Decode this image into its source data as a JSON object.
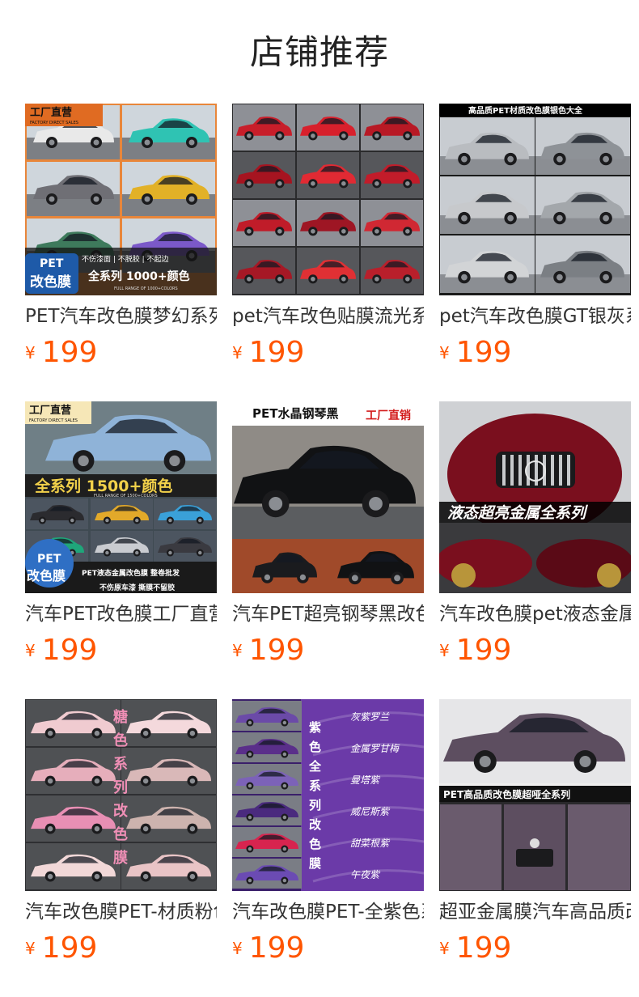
{
  "header": {
    "title": "店铺推荐"
  },
  "products": [
    {
      "name": "PET汽车改色膜梦幻系列",
      "currency": "¥",
      "price": "199",
      "image": {
        "kind": "grid-cars",
        "badge_top": "工厂直营",
        "badge_top_sub": "FACTORY DIRECT SALES",
        "badge_bottom": "PET",
        "badge_bottom_2": "改色膜",
        "tagline": "不伤漆面 | 不脱胶 | 不起边",
        "headline": "全系列 1000+颜色",
        "sub": "FULL RANGE OF 1000+COLORS",
        "colors": [
          "#e9e9e9",
          "#2fc3b3",
          "#6f6f75",
          "#e2b127",
          "#3e7a5c",
          "#7b59c9"
        ]
      }
    },
    {
      "name": "pet汽车改色贴膜流光系列",
      "currency": "¥",
      "price": "199",
      "image": {
        "kind": "red-grid",
        "colors": [
          "#c81e2a",
          "#d8202c",
          "#b81925",
          "#a61420",
          "#e12a33",
          "#c21c2a",
          "#c01c29",
          "#9e1624",
          "#d02833",
          "#a61825",
          "#e03034",
          "#b91f2b"
        ]
      }
    },
    {
      "name": "pet汽车改色膜GT银灰系列",
      "currency": "¥",
      "price": "199",
      "image": {
        "kind": "silver-grid",
        "banner": "高品质PET材质改色膜银色大全",
        "colors": [
          "#b9bcc0",
          "#8e9297",
          "#c7c9cc",
          "#a3a7ab",
          "#d2d4d6",
          "#7b7f84"
        ]
      }
    },
    {
      "name": "汽车PET改色膜工厂直营",
      "currency": "¥",
      "price": "199",
      "image": {
        "kind": "blue-hero",
        "badge_top": "工厂直营",
        "badge_top_sub": "FACTORY DIRECT SALES",
        "headline": "全系列 1500+颜色",
        "sub": "FULL RANGE OF 1500+COLORS",
        "badge_bottom": "PET",
        "badge_bottom_2": "改色膜",
        "strip_1": "PET液态金属改色膜 整卷批发",
        "strip_2": "不伤原车漆 撕膜不留胶",
        "colors": [
          "#8fb3d8",
          "#2b2b2f",
          "#e2a92a",
          "#3aa0d8",
          "#c9cbd0",
          "#3a3a40",
          "#1fa67a",
          "#2c9f8a"
        ]
      }
    },
    {
      "name": "汽车PET超亮钢琴黑改色膜",
      "currency": "¥",
      "price": "199",
      "image": {
        "kind": "black-hero",
        "banner": "PET水晶钢琴黑",
        "banner_red": "工厂直销",
        "colors": [
          "#111214",
          "#1a1b1e"
        ]
      }
    },
    {
      "name": "汽车改色膜pet液态金属全系列",
      "currency": "¥",
      "price": "199",
      "image": {
        "kind": "maroon-hero",
        "banner": "液态超亮金属全系列",
        "colors": [
          "#7a0f1e",
          "#5a0a16"
        ]
      }
    },
    {
      "name": "汽车改色膜PET-材质粉色系列",
      "currency": "¥",
      "price": "199",
      "image": {
        "kind": "pink-grid",
        "vertical": [
          "糖",
          "色",
          "系",
          "列",
          "改",
          "色",
          "膜"
        ],
        "colors": [
          "#f0cbd0",
          "#f4d9dc",
          "#e6aebb",
          "#d9b8b8",
          "#e88fb4",
          "#cdb3ae",
          "#f2d8d8",
          "#e9c4c6"
        ]
      }
    },
    {
      "name": "汽车改色膜PET-全紫色系列",
      "currency": "¥",
      "price": "199",
      "image": {
        "kind": "purple-list",
        "vertical": [
          "紫",
          "色",
          "全",
          "系",
          "列",
          "改",
          "色",
          "膜"
        ],
        "labels": [
          "灰紫罗兰",
          "金属罗甘梅",
          "曼塔紫",
          "威尼斯紫",
          "甜菜根紫",
          "午夜紫"
        ],
        "colors": [
          "#6b4aa8",
          "#5a2f8a",
          "#7c62b8",
          "#4a2a7e",
          "#d7244f",
          "#6b4bb3"
        ]
      }
    },
    {
      "name": "超亚金属膜汽车高品质改色膜",
      "currency": "¥",
      "price": "199",
      "image": {
        "kind": "matte-hero",
        "banner": "PET高品质改色膜超哑全系列",
        "colors": [
          "#5d4e60",
          "#3d343f"
        ]
      }
    }
  ]
}
